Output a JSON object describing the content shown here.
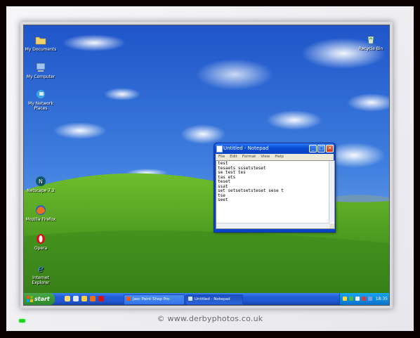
{
  "desktop_icons": [
    {
      "id": "my-documents",
      "label": "My Documents"
    },
    {
      "id": "my-computer",
      "label": "My Computer"
    },
    {
      "id": "network",
      "label": "My Network Places"
    },
    {
      "id": "netscape",
      "label": "Netscape 7.2"
    },
    {
      "id": "firefox",
      "label": "Mozilla Firefox"
    },
    {
      "id": "opera",
      "label": "Opera"
    },
    {
      "id": "ie",
      "label": "Internet Explorer"
    },
    {
      "id": "recycle",
      "label": "Recycle Bin"
    }
  ],
  "notepad": {
    "title": "Untitled - Notepad",
    "menu": [
      "File",
      "Edit",
      "Format",
      "View",
      "Help"
    ],
    "content": "test\ntesaets sssetsteset\nse test tes\ntas ets\nteset\nssat\nset setsetsetsteset sese t\ntse\nseet",
    "buttons": {
      "minimize": "_",
      "maximize": "□",
      "close": "✕"
    }
  },
  "taskbar": {
    "start_label": "start",
    "tasks": [
      {
        "label": "Jasc Paint Shop Pro",
        "active": false
      },
      {
        "label": "Untitled - Notepad",
        "active": true
      }
    ],
    "clock": "18:35"
  },
  "watermark": "© www.derbyphotos.co.uk",
  "colors": {
    "taskbar": "#245edb",
    "start": "#3c9a3c",
    "sky": "#3a6fd6",
    "grass": "#3f8d1c"
  }
}
